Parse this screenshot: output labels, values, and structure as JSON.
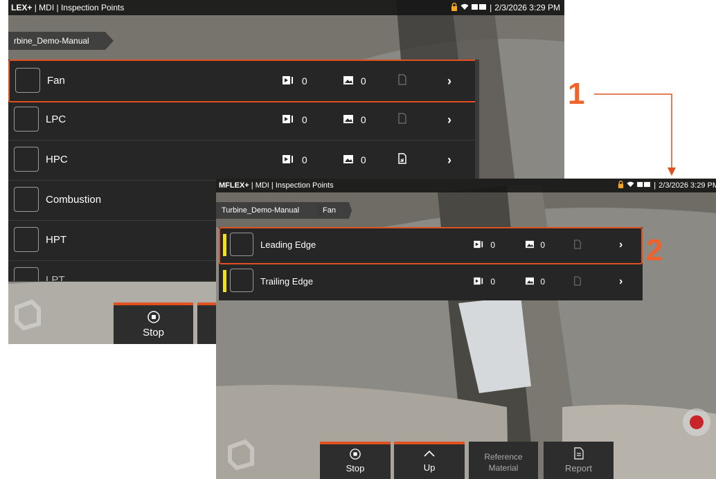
{
  "colors": {
    "accent": "#e0511f",
    "callout": "#f0622a",
    "indicator": "#f0e020",
    "row_bg": "#262626",
    "record": "#c8242a"
  },
  "screen1": {
    "status_title_part": "LEX+",
    "status_title_rest": "MDI | Inspection Points",
    "datetime": "2/3/2026  3:29 PM",
    "breadcrumb": "rbine_Demo-Manual",
    "rows": [
      {
        "label": "Fan",
        "videos": "0",
        "images": "0",
        "selected": true
      },
      {
        "label": "LPC",
        "videos": "0",
        "images": "0"
      },
      {
        "label": "HPC",
        "videos": "0",
        "images": "0"
      },
      {
        "label": "Combustion",
        "videos": "",
        "images": ""
      },
      {
        "label": "HPT",
        "videos": "",
        "images": ""
      },
      {
        "label": "LPT",
        "videos": "",
        "images": ""
      }
    ],
    "stop_label": "Stop"
  },
  "screen2": {
    "status_title_part": "MFLEX+",
    "status_title_rest": "MDI | Inspection Points",
    "datetime": "2/3/2026  3:29 PM",
    "breadcrumbs": [
      "Turbine_Demo-Manual",
      "Fan"
    ],
    "rows": [
      {
        "label": "Leading Edge",
        "videos": "0",
        "images": "0",
        "selected": true
      },
      {
        "label": "Trailing Edge",
        "videos": "0",
        "images": "0"
      }
    ],
    "buttons": {
      "stop": "Stop",
      "up": "Up",
      "reference_line1": "Reference",
      "reference_line2": "Material",
      "report": "Report"
    }
  },
  "callouts": {
    "one": "1",
    "two": "2"
  },
  "icons": [
    "video-icon",
    "image-icon",
    "report-icon",
    "chevron-right-icon",
    "lock-icon",
    "wifi-icon",
    "battery-icon",
    "stop-icon",
    "up-icon",
    "document-icon",
    "record-icon",
    "logo-icon"
  ]
}
